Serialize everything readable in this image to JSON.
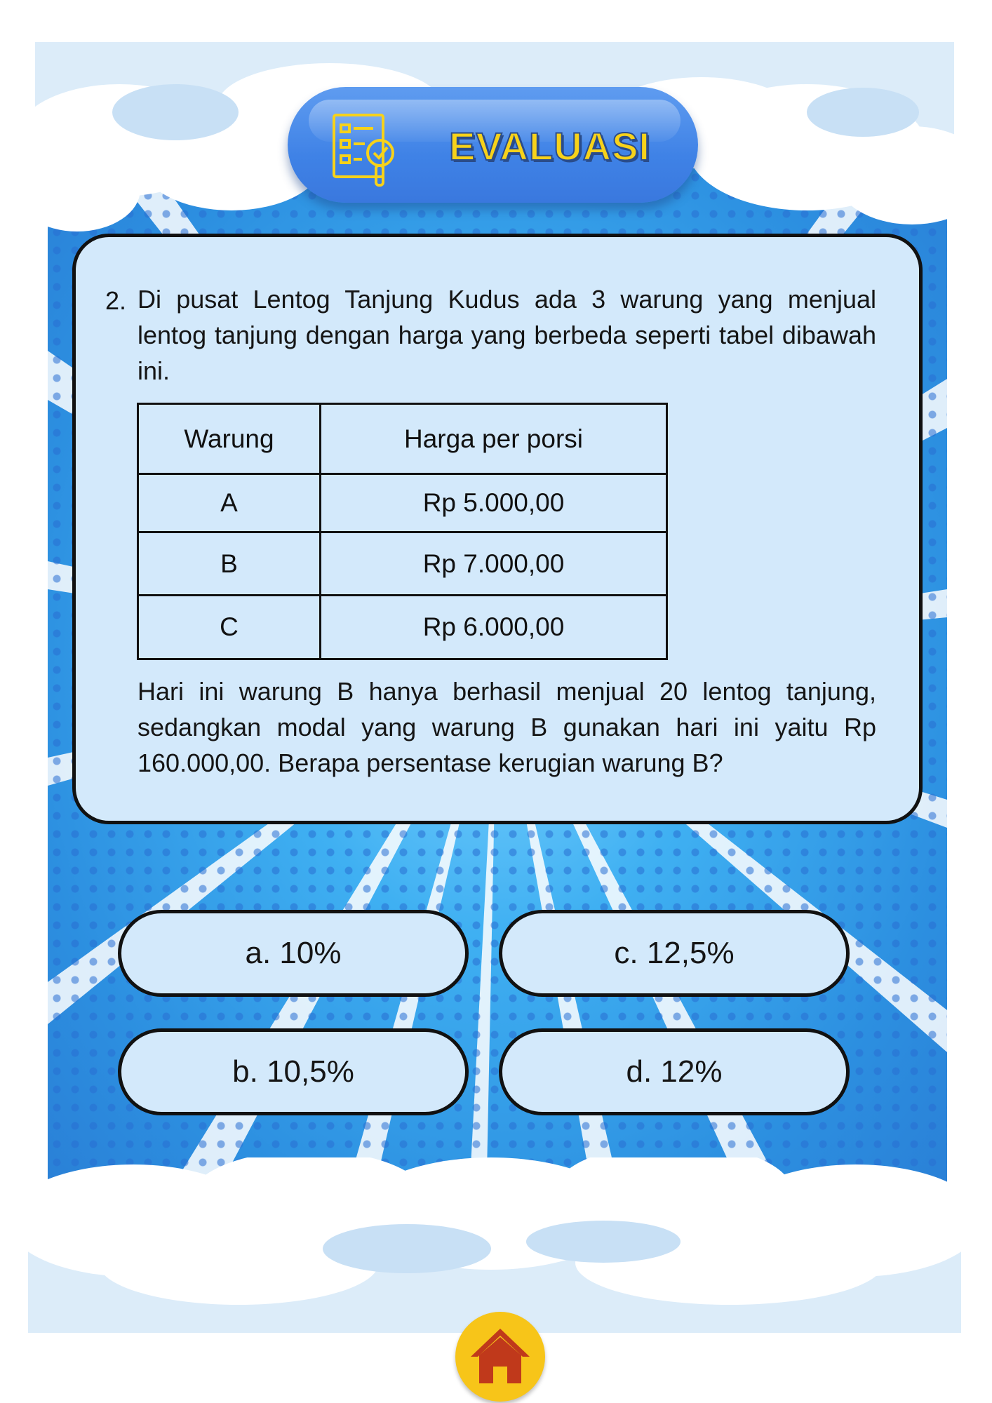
{
  "header": {
    "title": "EVALUASI",
    "icon": "checklist-icon"
  },
  "question": {
    "number": "2.",
    "intro": "Di pusat Lentog Tanjung Kudus ada 3 warung yang menjual lentog tanjung dengan harga yang berbeda seperti tabel dibawah ini.",
    "table": {
      "headers": [
        "Warung",
        "Harga per porsi"
      ],
      "rows": [
        [
          "A",
          "Rp 5.000,00"
        ],
        [
          "B",
          "Rp 7.000,00"
        ],
        [
          "C",
          "Rp 6.000,00"
        ]
      ]
    },
    "followup": "Hari ini warung B hanya berhasil menjual 20 lentog tanjung, sedangkan modal yang warung B gunakan hari ini yaitu Rp 160.000,00. Berapa persentase kerugian warung B?"
  },
  "options": {
    "a": "a. 10%",
    "b": "b. 10,5%",
    "c": "c. 12,5%",
    "d": "d. 12%"
  },
  "footer": {
    "home_icon": "home-icon"
  },
  "colors": {
    "card_fill": "#d3e9fb",
    "title_text": "#f7d21a",
    "title_pill": "#3f82e6",
    "home_button": "#f7c519",
    "home_glyph": "#c0391b"
  }
}
